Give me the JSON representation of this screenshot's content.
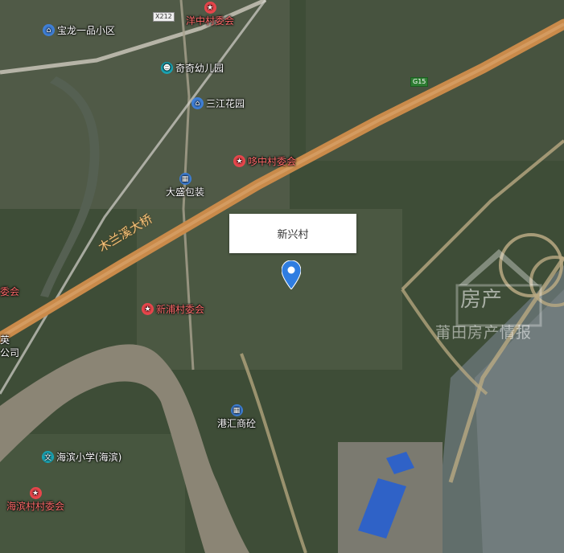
{
  "map": {
    "callout_title": "新兴村",
    "bridge": "木兰溪大桥",
    "roads": {
      "x212": "X212",
      "g15": "G15"
    },
    "pois": [
      {
        "label": "宝龙一品小区",
        "icon": "residential-icon",
        "color": "white"
      },
      {
        "label": "洋中村委会",
        "icon": "government-icon",
        "color": "red"
      },
      {
        "label": "奇奇幼儿园",
        "icon": "kindergarten-icon",
        "color": "white"
      },
      {
        "label": "三江花园",
        "icon": "residential-icon",
        "color": "white"
      },
      {
        "label": "哆中村委会",
        "icon": "government-icon",
        "color": "red"
      },
      {
        "label": "大盛包装",
        "icon": "company-icon",
        "color": "white"
      },
      {
        "label": "新浦村委会",
        "icon": "government-icon",
        "color": "red"
      },
      {
        "label": "港汇商砼",
        "icon": "company-icon",
        "color": "white"
      },
      {
        "label": "海滨小学(海滨)",
        "icon": "school-icon",
        "color": "white"
      },
      {
        "label": "海滨村村委会",
        "icon": "government-icon",
        "color": "red"
      },
      {
        "label": "委会",
        "icon": "",
        "color": "red"
      },
      {
        "label": "英",
        "icon": "",
        "color": "white"
      },
      {
        "label": "公司",
        "icon": "",
        "color": "white"
      }
    ],
    "watermark": {
      "line1": "房产",
      "line2": "莆田房产情报"
    },
    "colors": {
      "highway": "#c98a4a",
      "pin": "#2f7de1",
      "river": "#8b8575",
      "poi_red": "#e8464c"
    }
  }
}
